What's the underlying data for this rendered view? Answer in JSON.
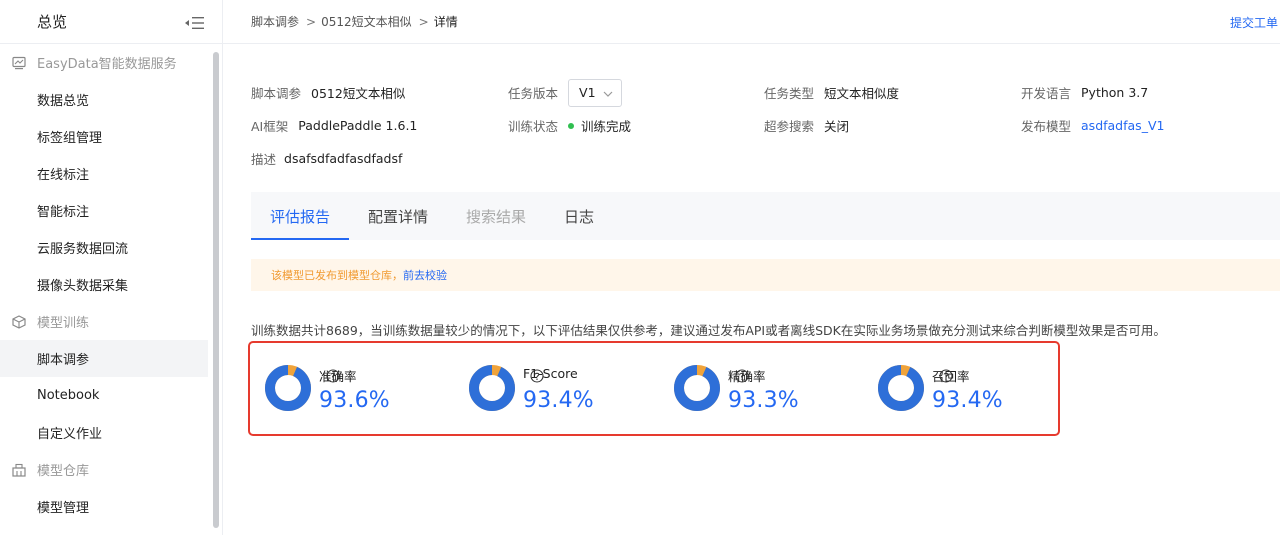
{
  "sidebar": {
    "title": "总览",
    "sections": [
      {
        "label": "EasyData智能数据服务",
        "icon": "data-monitor-icon",
        "items": [
          "数据总览",
          "标签组管理",
          "在线标注",
          "智能标注",
          "云服务数据回流",
          "摄像头数据采集"
        ]
      },
      {
        "label": "模型训练",
        "icon": "cube-icon",
        "items": [
          "脚本调参",
          "Notebook",
          "自定义作业"
        ]
      },
      {
        "label": "模型仓库",
        "icon": "warehouse-icon",
        "items": [
          "模型管理"
        ]
      }
    ],
    "active_item": "脚本调参"
  },
  "breadcrumb": [
    "脚本调参",
    "0512短文本相似",
    "详情"
  ],
  "ticket_link": "提交工单",
  "info": {
    "script_label": "脚本调参",
    "script_value": "0512短文本相似",
    "version_label": "任务版本",
    "version_value": "V1",
    "task_type_label": "任务类型",
    "task_type_value": "短文本相似度",
    "dev_lang_label": "开发语言",
    "dev_lang_value": "Python 3.7",
    "ai_framework_label": "AI框架",
    "ai_framework_value": "PaddlePaddle 1.6.1",
    "train_status_label": "训练状态",
    "train_status_value": "训练完成",
    "hyper_search_label": "超参搜索",
    "hyper_search_value": "关闭",
    "publish_model_label": "发布模型",
    "publish_model_value": "asdfadfas_V1",
    "desc_label": "描述",
    "desc_value": "dsafsdfadfasdfadsf"
  },
  "tabs": [
    {
      "label": "评估报告",
      "state": "active"
    },
    {
      "label": "配置详情",
      "state": "normal"
    },
    {
      "label": "搜索结果",
      "state": "disabled"
    },
    {
      "label": "日志",
      "state": "normal"
    }
  ],
  "notice": {
    "text": "该模型已发布到模型仓库，",
    "link": "前去校验"
  },
  "description": "训练数据共计8689，当训练数据量较少的情况下，以下评估结果仅供参考，建议通过发布API或者离线SDK在实际业务场景做充分测试来综合判断模型效果是否可用。",
  "metrics": [
    {
      "name": "准确率",
      "value": "93.6%",
      "ratio": 0.936
    },
    {
      "name": "F1-Score",
      "value": "93.4%",
      "ratio": 0.934
    },
    {
      "name": "精确率",
      "value": "93.3%",
      "ratio": 0.933
    },
    {
      "name": "召回率",
      "value": "93.4%",
      "ratio": 0.934
    }
  ],
  "colors": {
    "accent": "#2468f2",
    "donut_main": "#2e6fd8",
    "donut_rest": "#f0a33a",
    "highlight_border": "#e63a2e",
    "status_ok": "#30bf50"
  }
}
